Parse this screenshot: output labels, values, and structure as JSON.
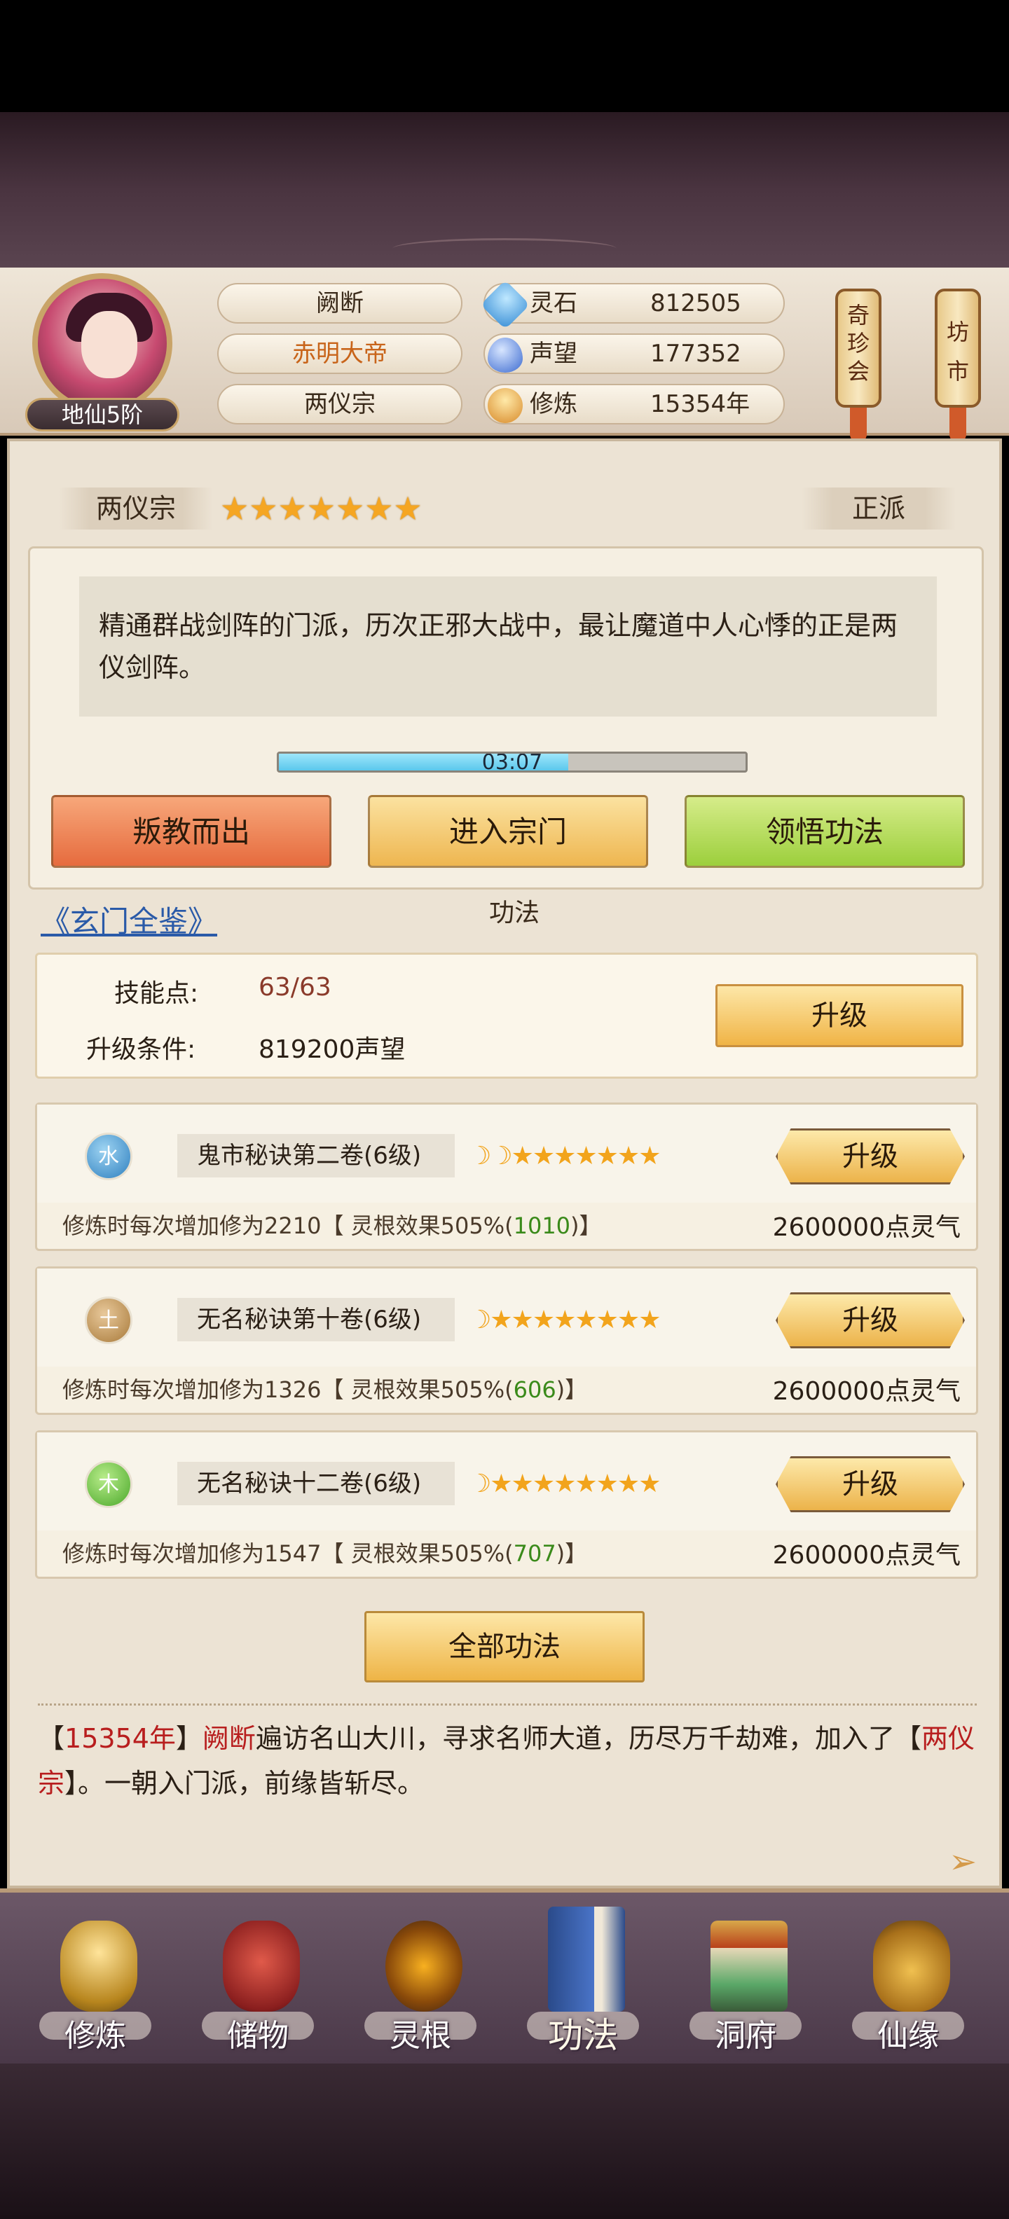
{
  "header": {
    "rank": "地仙5阶",
    "player_name": "阙断",
    "title": "赤明大帝",
    "sect": "两仪宗",
    "resources": [
      {
        "icon": "spirit-stone-icon",
        "label": "灵石",
        "value": "812505"
      },
      {
        "icon": "reputation-icon",
        "label": "声望",
        "value": "177352"
      },
      {
        "icon": "cultivation-icon",
        "label": "修炼",
        "value": "15354年"
      }
    ],
    "lanterns": [
      {
        "label": "奇珍会"
      },
      {
        "label": "坊市"
      }
    ]
  },
  "sect_panel": {
    "name": "两仪宗",
    "star_count": 7,
    "stars": "★★★★★★★",
    "alignment": "正派",
    "description": "精通群战剑阵的门派，历次正邪大战中，最让魔道中人心悸的正是两仪剑阵。",
    "timer": "03:07",
    "timer_progress": 0.62,
    "buttons": {
      "leave": "叛教而出",
      "enter": "进入宗门",
      "comprehend": "领悟功法"
    }
  },
  "catalog_link": "《玄门全鉴》",
  "skills_section": {
    "title": "功法",
    "skill_points_label": "技能点:",
    "skill_points_value": "63/63",
    "upgrade_condition_label": "升级条件:",
    "upgrade_condition_value": "819200声望",
    "upgrade_button": "升级"
  },
  "skills": [
    {
      "element": "水",
      "name": "鬼市秘诀第二卷(6级)",
      "stars": "☽☽★★★★★★★",
      "upgrade_label": "升级",
      "desc_prefix": "修炼时每次增加修为2210【 灵根效果505%(",
      "desc_green": "1010",
      "desc_suffix": ")】",
      "cost": "2600000点灵气"
    },
    {
      "element": "土",
      "name": "无名秘诀第十卷(6级)",
      "stars": "☽★★★★★★★★",
      "upgrade_label": "升级",
      "desc_prefix": "修炼时每次增加修为1326【 灵根效果505%(",
      "desc_green": "606",
      "desc_suffix": ")】",
      "cost": "2600000点灵气"
    },
    {
      "element": "木",
      "name": "无名秘诀十二卷(6级)",
      "stars": "☽★★★★★★★★",
      "upgrade_label": "升级",
      "desc_prefix": "修炼时每次增加修为1547【 灵根效果505%(",
      "desc_green": "707",
      "desc_suffix": ")】",
      "cost": "2600000点灵气"
    }
  ],
  "all_skills_button": "全部功法",
  "story": {
    "p1": "【",
    "year": "15354年",
    "p2": "】",
    "name": "阙断",
    "p3": "遍访名山大川，寻求名师大道，历尽万千劫难，加入了【",
    "sect": "两仪宗",
    "p4": "】。一朝入门派，前缘皆斩尽。"
  },
  "bottom_nav": [
    {
      "label": "修炼",
      "icon": "meditation-icon"
    },
    {
      "label": "储物",
      "icon": "treasure-bag-icon"
    },
    {
      "label": "灵根",
      "icon": "spirit-root-icon"
    },
    {
      "label": "功法",
      "icon": "skill-book-icon"
    },
    {
      "label": "洞府",
      "icon": "cave-dwelling-icon"
    },
    {
      "label": "仙缘",
      "icon": "immortal-fate-icon"
    }
  ]
}
